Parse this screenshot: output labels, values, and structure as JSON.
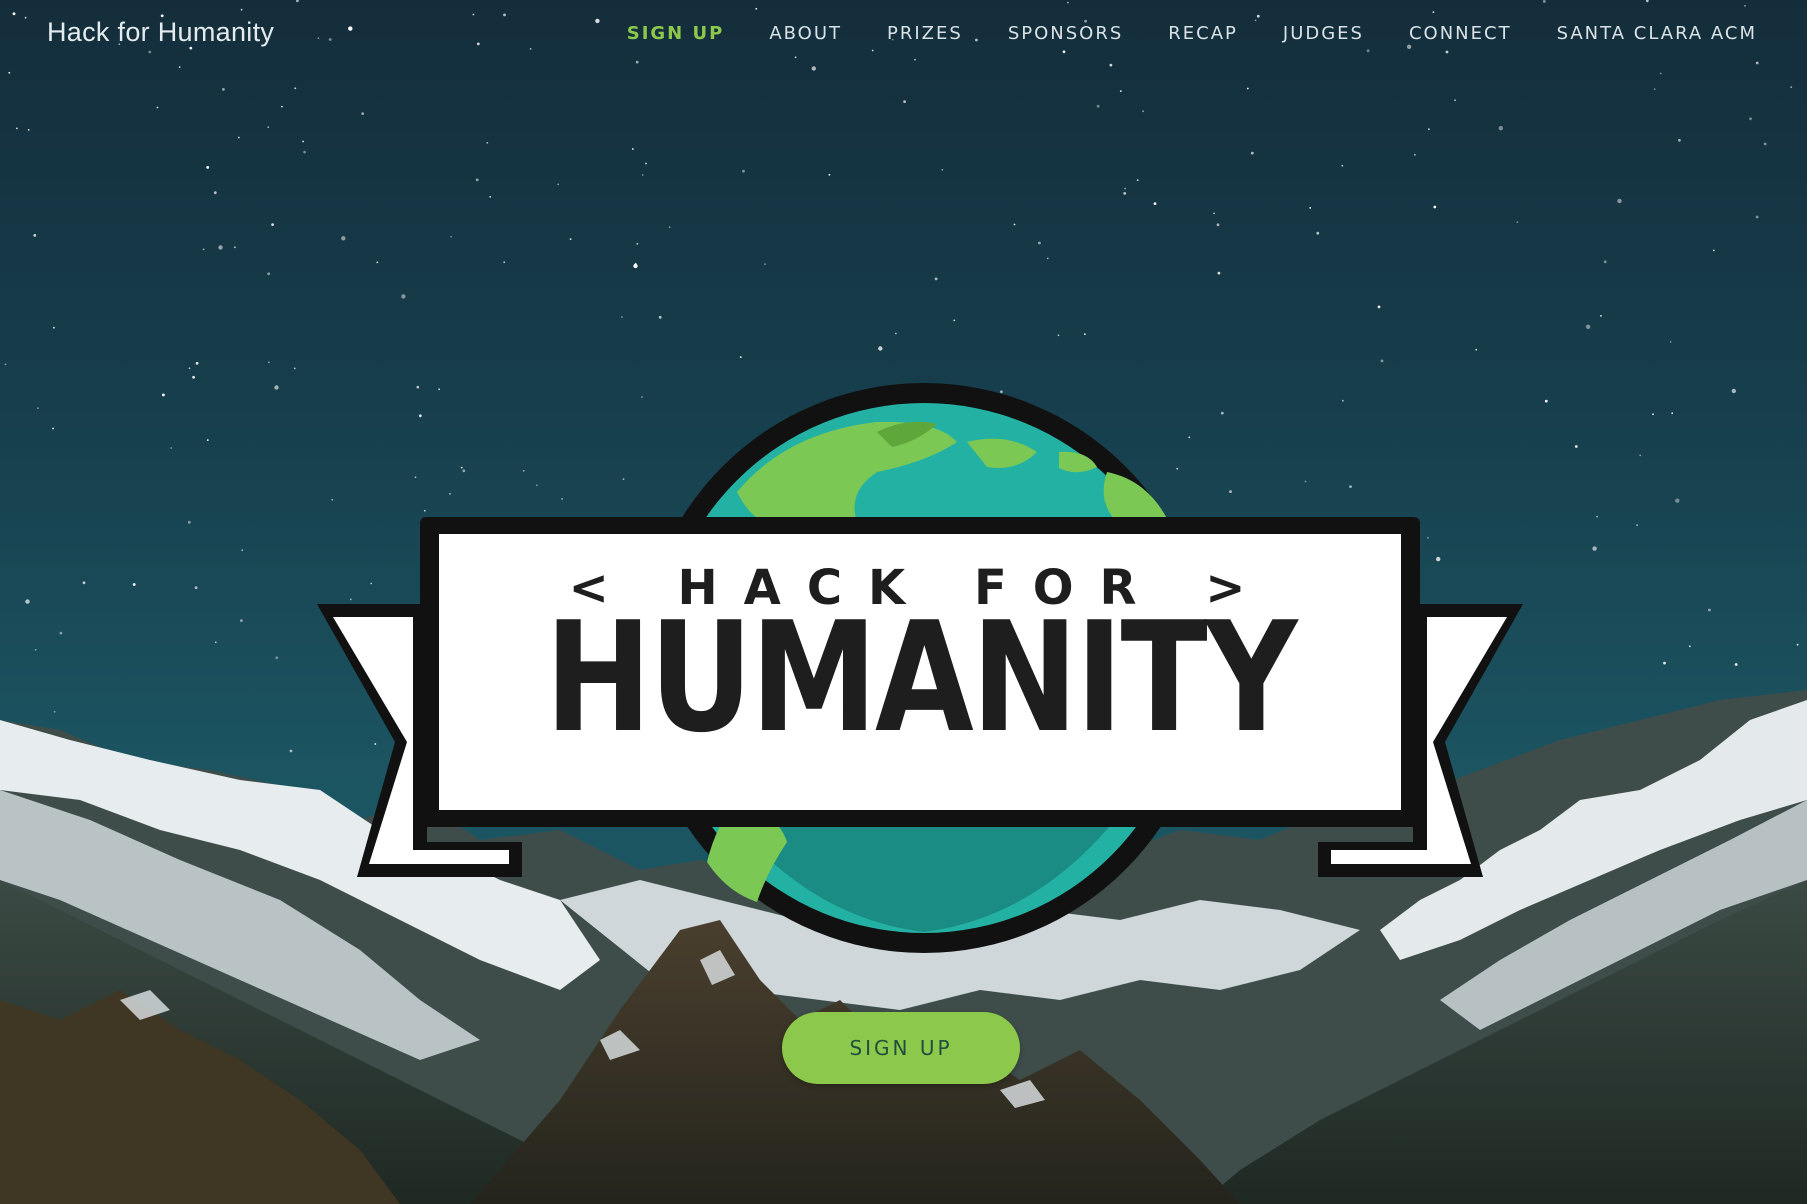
{
  "page": {
    "brand": "Hack for Humanity"
  },
  "nav": {
    "items": [
      {
        "label": "SIGN UP",
        "active": true
      },
      {
        "label": "ABOUT",
        "active": false
      },
      {
        "label": "PRIZES",
        "active": false
      },
      {
        "label": "SPONSORS",
        "active": false
      },
      {
        "label": "RECAP",
        "active": false
      },
      {
        "label": "JUDGES",
        "active": false
      },
      {
        "label": "CONNECT",
        "active": false
      },
      {
        "label": "SANTA CLARA ACM",
        "active": false
      }
    ]
  },
  "hero": {
    "logo_top": "< HACK FOR >",
    "logo_main": "HUMANITY",
    "cta_label": "SIGN UP"
  },
  "colors": {
    "accent": "#8cc84b",
    "nav_text": "#d9e2e6",
    "sky": "#1b5361",
    "globe_ocean": "#22b1a3",
    "globe_land": "#7cc855"
  }
}
